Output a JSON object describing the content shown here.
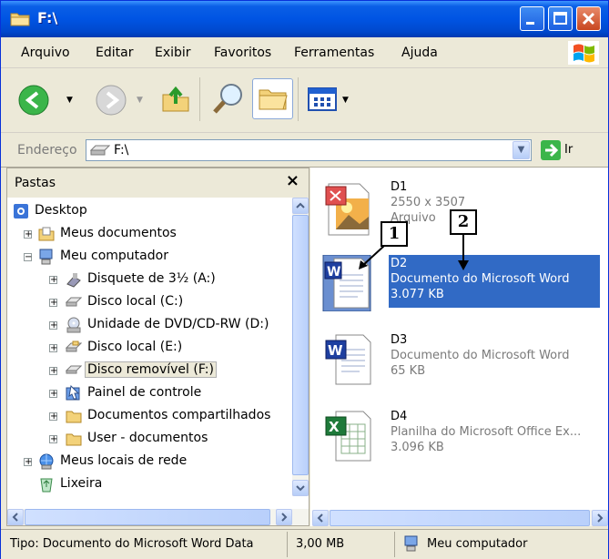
{
  "window": {
    "title": "F:\\"
  },
  "menu": [
    "Arquivo",
    "Editar",
    "Exibir",
    "Favoritos",
    "Ferramentas",
    "Ajuda"
  ],
  "address": {
    "label": "Endereço",
    "value": "F:\\",
    "go_label": "Ir"
  },
  "folders_pane": {
    "title": "Pastas",
    "tree": [
      {
        "label": "Desktop",
        "icon": "desktop-icon"
      },
      {
        "label": "Meus documentos",
        "icon": "my-documents-icon"
      },
      {
        "label": "Meu computador",
        "icon": "my-computer-icon"
      },
      {
        "label": "Disquete de 3½ (A:)",
        "icon": "floppy-icon"
      },
      {
        "label": "Disco local (C:)",
        "icon": "hard-drive-icon"
      },
      {
        "label": "Unidade de DVD/CD-RW (D:)",
        "icon": "dvd-drive-icon"
      },
      {
        "label": "Disco local (E:)",
        "icon": "hard-drive-icon"
      },
      {
        "label": "Disco removível (F:)",
        "icon": "removable-drive-icon"
      },
      {
        "label": "Painel de controle",
        "icon": "control-panel-icon"
      },
      {
        "label": "Documentos compartilhados",
        "icon": "folder-icon"
      },
      {
        "label": "User - documentos",
        "icon": "folder-icon"
      },
      {
        "label": "Meus locais de rede",
        "icon": "network-icon"
      },
      {
        "label": "Lixeira",
        "icon": "recycle-bin-icon"
      }
    ]
  },
  "files": [
    {
      "name": "D1",
      "type": "2550 x 3507",
      "size": "Arquivo",
      "icon": "image-file-icon"
    },
    {
      "name": "D2",
      "type": "Documento do Microsoft Word",
      "size": "3.077 KB",
      "icon": "word-document-icon",
      "selected": true
    },
    {
      "name": "D3",
      "type": "Documento do Microsoft Word",
      "size": "65 KB",
      "icon": "word-document-icon"
    },
    {
      "name": "D4",
      "type": "Planilha do Microsoft Office Ex...",
      "size": "3.096 KB",
      "icon": "excel-spreadsheet-icon"
    }
  ],
  "annotations": [
    "1",
    "2"
  ],
  "status": {
    "type_text": "Tipo: Documento do Microsoft Word Data",
    "size_text": "3,00 MB",
    "location": "Meu computador"
  }
}
